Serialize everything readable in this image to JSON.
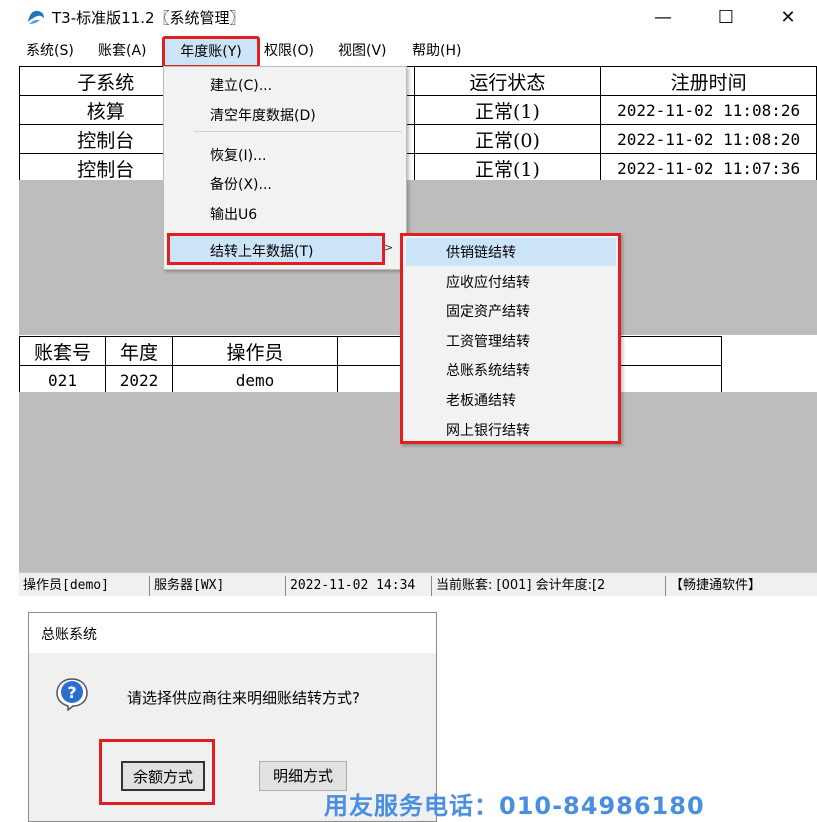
{
  "window": {
    "title": "T3-标准版11.2〖系统管理〗",
    "minimize": "—",
    "maximize": "☐",
    "close": "✕"
  },
  "menubar": {
    "items": [
      "系统(S)",
      "账套(A)",
      "年度账(Y)",
      "权限(O)",
      "视图(V)",
      "帮助(H)"
    ]
  },
  "subsystem_table": {
    "headers": [
      "子系统",
      "运行状态",
      "注册时间"
    ],
    "rows": [
      [
        "核算",
        "正常(1)",
        "2022-11-02 11:08:26"
      ],
      [
        "控制台",
        "正常(0)",
        "2022-11-02 11:08:20"
      ],
      [
        "控制台",
        "正常(1)",
        "2022-11-02 11:07:36"
      ]
    ]
  },
  "account_table": {
    "headers": [
      "账套号",
      "年度",
      "操作员"
    ],
    "rows": [
      [
        "021",
        "2022",
        "demo"
      ]
    ]
  },
  "year_menu": {
    "items": [
      "建立(C)...",
      "清空年度数据(D)",
      "恢复(I)...",
      "备份(X)...",
      "输出U6",
      "结转上年数据(T)"
    ],
    "arrow": ">"
  },
  "carry_submenu": {
    "items": [
      "供销链结转",
      "应收应付结转",
      "固定资产结转",
      "工资管理结转",
      "总账系统结转",
      "老板通结转",
      "网上银行结转"
    ]
  },
  "statusbar": {
    "operator": "操作员[demo]",
    "server": "服务器[WX]",
    "datetime": "2022-11-02 14:34",
    "account": "当前账套: [001] 会计年度:[2",
    "brand": "【畅捷通软件】"
  },
  "dialog": {
    "title": "总账系统",
    "message": "请选择供应商往来明细账结转方式?",
    "btn_balance": "余额方式",
    "btn_detail": "明细方式"
  },
  "watermark": "用友服务电话：010-84986180",
  "colors": {
    "highlight_red": "#e02020",
    "menu_hover": "#cce4f7",
    "grid_gray": "#bdbdbd",
    "watermark_blue": "#4a8ee0"
  }
}
